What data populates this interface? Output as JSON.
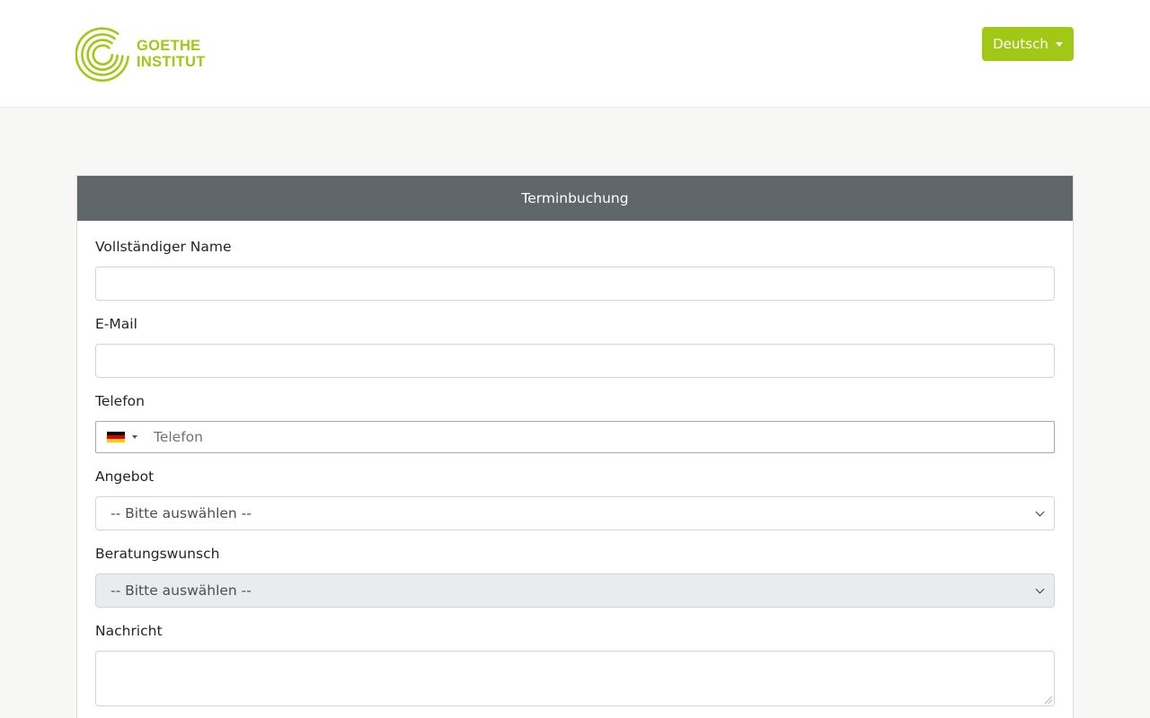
{
  "header": {
    "logo": {
      "line1": "GOETHE",
      "line2": "INSTITUT"
    },
    "language_button": "Deutsch"
  },
  "colors": {
    "brand_green": "#a0c814",
    "card_header": "#5f676b"
  },
  "form": {
    "title": "Terminbuchung",
    "name": {
      "label": "Vollständiger Name",
      "value": ""
    },
    "email": {
      "label": "E-Mail",
      "value": ""
    },
    "phone": {
      "label": "Telefon",
      "placeholder": "Telefon",
      "country_icon": "germany-flag-icon"
    },
    "offer": {
      "label": "Angebot",
      "selected": "-- Bitte auswählen --"
    },
    "consultation": {
      "label": "Beratungswunsch",
      "selected": "-- Bitte auswählen --"
    },
    "message": {
      "label": "Nachricht",
      "value": ""
    }
  }
}
